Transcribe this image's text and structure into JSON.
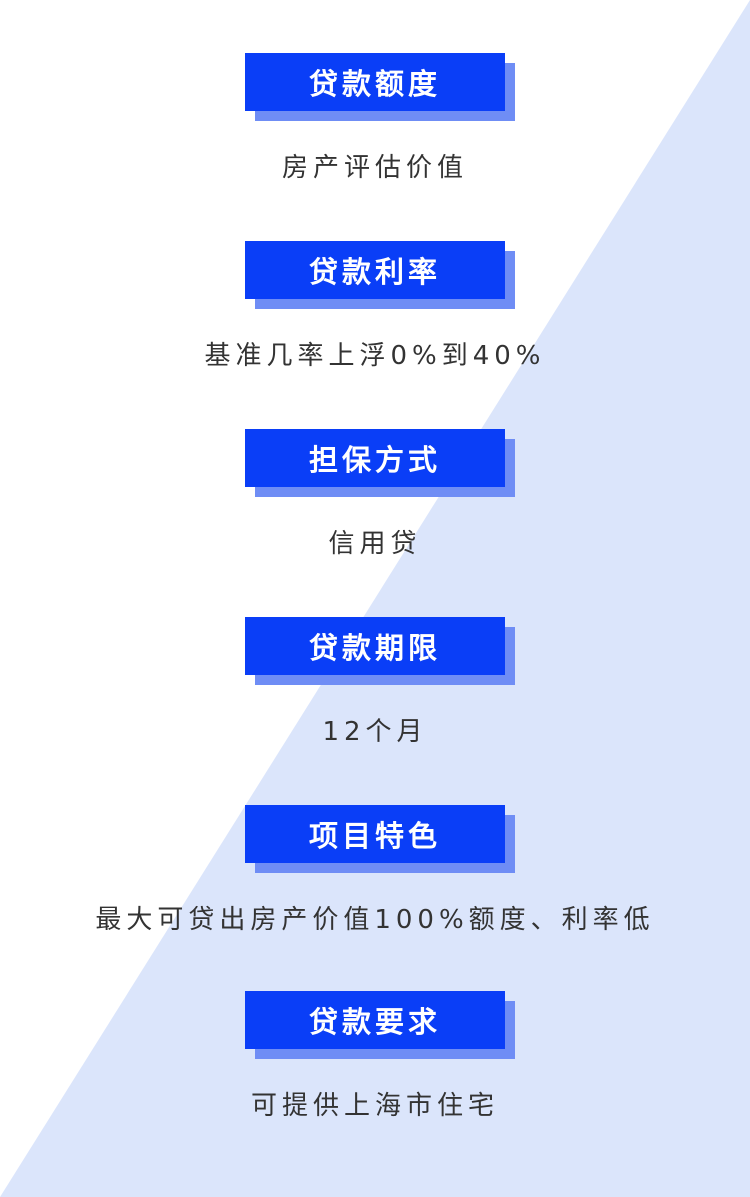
{
  "colors": {
    "badge_bg": "#0a3ef7",
    "badge_shadow": "#6f8df5",
    "triangle": "#dbe5fb",
    "value_text": "#333333"
  },
  "sections": [
    {
      "title": "贷款额度",
      "value": "房产评估价值"
    },
    {
      "title": "贷款利率",
      "value": "基准几率上浮0%到40%"
    },
    {
      "title": "担保方式",
      "value": "信用贷"
    },
    {
      "title": "贷款期限",
      "value": "12个月"
    },
    {
      "title": "项目特色",
      "value": "最大可贷出房产价值100%额度、利率低"
    },
    {
      "title": "贷款要求",
      "value": "可提供上海市住宅"
    }
  ]
}
